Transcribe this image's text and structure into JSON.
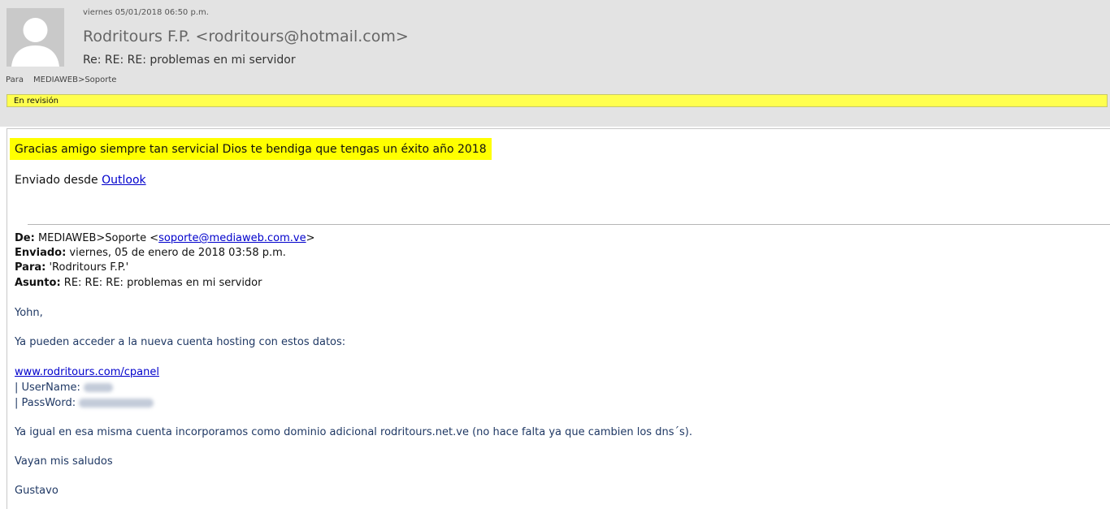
{
  "header": {
    "date": "viernes 05/01/2018 06:50 p.m.",
    "from": "Rodritours F.P. <rodritours@hotmail.com>",
    "subject": "Re: RE: RE: problemas en mi servidor",
    "to_label": "Para",
    "to_value": "MEDIAWEB>Soporte",
    "flag": "En revisión"
  },
  "message": {
    "highlight": "Gracias amigo siempre tan servicial Dios te bendiga que tengas un éxito año 2018",
    "sent_from_prefix": "Enviado desde ",
    "sent_from_link": "Outlook"
  },
  "quoted": {
    "de_label": "De:",
    "de_value": " MEDIAWEB>Soporte <",
    "de_email": "soporte@mediaweb.com.ve",
    "de_suffix": ">",
    "enviado_label": "Enviado:",
    "enviado_value": " viernes, 05 de enero de 2018 03:58 p.m.",
    "para_label": "Para:",
    "para_value": " 'Rodritours F.P.'",
    "asunto_label": "Asunto:",
    "asunto_value": " RE: RE: RE: problemas en mi servidor",
    "greeting": "Yohn,",
    "line1": "Ya pueden acceder a la nueva cuenta hosting con estos datos:",
    "url": "www.rodritours.com/cpanel",
    "username_label": "| UserName:",
    "password_label": "| PassWord:",
    "line2": "Ya igual en esa misma cuenta incorporamos como dominio adicional rodritours.net.ve (no hace falta ya que cambien los dns´s).",
    "closing": "Vayan mis saludos",
    "signature": "Gustavo"
  },
  "icons": {
    "avatar": "person-silhouette-icon"
  },
  "colors": {
    "flag_bar": "#ffff4f",
    "highlight": "#ffff00",
    "link": "#0000cc",
    "reply_text": "#1f3864"
  }
}
